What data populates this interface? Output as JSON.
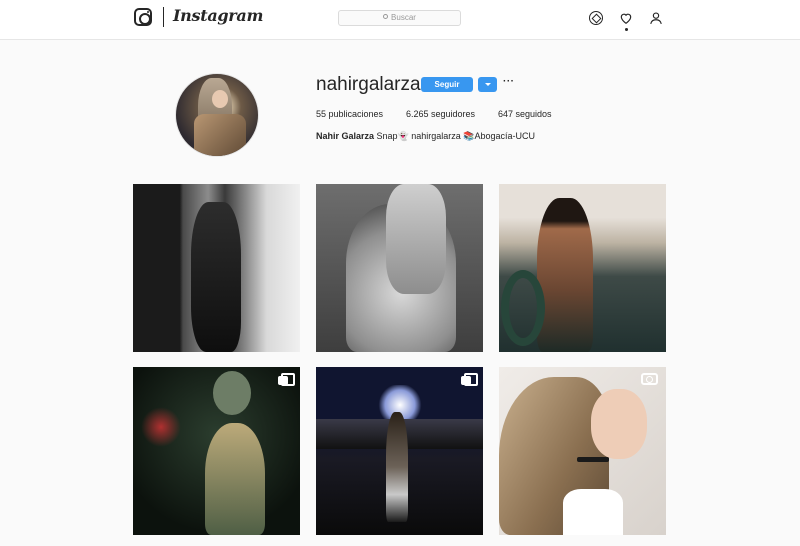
{
  "header": {
    "wordmark": "Instagram",
    "search_placeholder": "Buscar",
    "icons": [
      "instagram-logo-icon",
      "explore-compass-icon",
      "heart-icon",
      "profile-icon"
    ]
  },
  "profile": {
    "username": "nahirgalarza",
    "follow_label": "Seguir",
    "more_label": "···",
    "stats": {
      "posts": "55 publicaciones",
      "followers": "6.265 seguidores",
      "following": "647 seguidos"
    },
    "bio_name": "Nahir Galarza",
    "bio_text": " Snap👻 nahirgalarza 📚Abogacía-UCU"
  },
  "grid": {
    "posts": [
      {
        "badge": ""
      },
      {
        "badge": ""
      },
      {
        "badge": ""
      },
      {
        "badge": "multiple-photos-icon"
      },
      {
        "badge": "multiple-photos-icon"
      },
      {
        "badge": "video-icon"
      }
    ]
  },
  "colors": {
    "accent": "#3897f0",
    "text": "#262626",
    "background": "#fafafa"
  }
}
